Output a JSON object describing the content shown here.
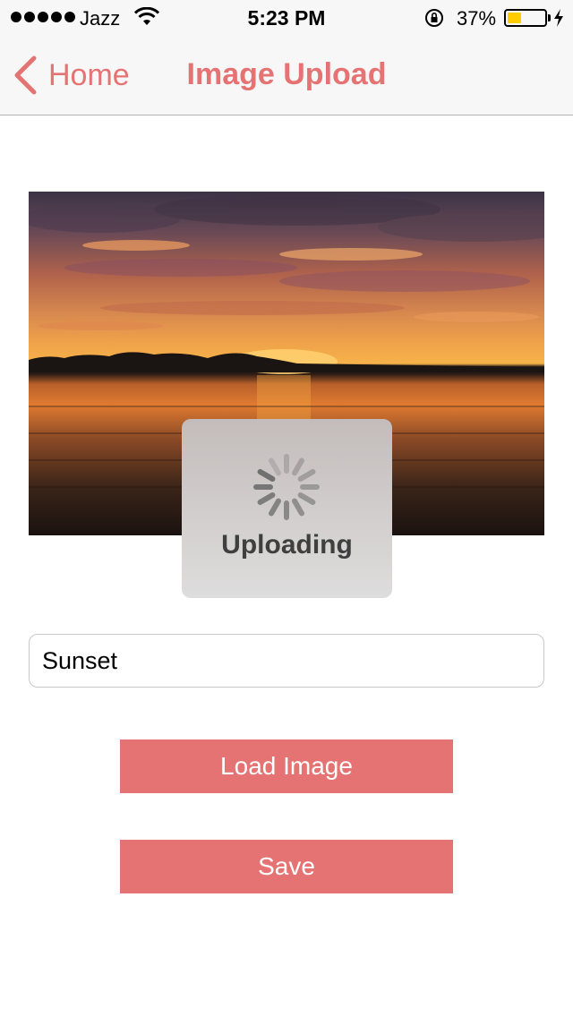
{
  "status_bar": {
    "carrier": "Jazz",
    "time": "5:23 PM",
    "battery_percent": "37%",
    "battery_level": 0.37,
    "battery_color": "#ffcc00"
  },
  "nav": {
    "back_label": "Home",
    "title": "Image Upload",
    "accent_color": "#e57373"
  },
  "image": {
    "description_icon": "sunset-photo"
  },
  "upload_hud": {
    "label": "Uploading"
  },
  "form": {
    "name_value": "Sunset"
  },
  "buttons": {
    "load_label": "Load Image",
    "save_label": "Save"
  }
}
